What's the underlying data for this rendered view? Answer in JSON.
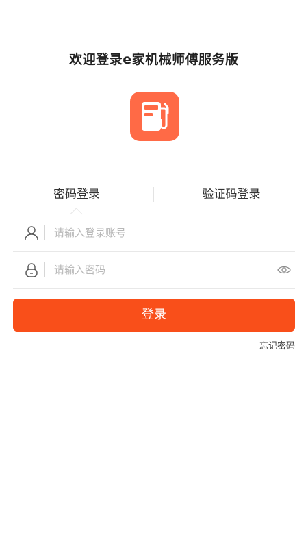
{
  "header": {
    "title": "欢迎登录e家机械师傅服务版"
  },
  "logo": {
    "icon": "fuel-pump-icon",
    "color": "#ff6a46"
  },
  "tabs": [
    {
      "label": "密码登录",
      "active": true
    },
    {
      "label": "验证码登录",
      "active": false
    }
  ],
  "form": {
    "account": {
      "placeholder": "请输入登录账号",
      "value": "",
      "icon": "user-icon"
    },
    "password": {
      "placeholder": "请输入密码",
      "value": "",
      "icon": "lock-icon",
      "toggle_icon": "eye-icon"
    }
  },
  "login_button": {
    "label": "登录",
    "color": "#f94f1a"
  },
  "forgot_link": {
    "label": "忘记密码"
  }
}
